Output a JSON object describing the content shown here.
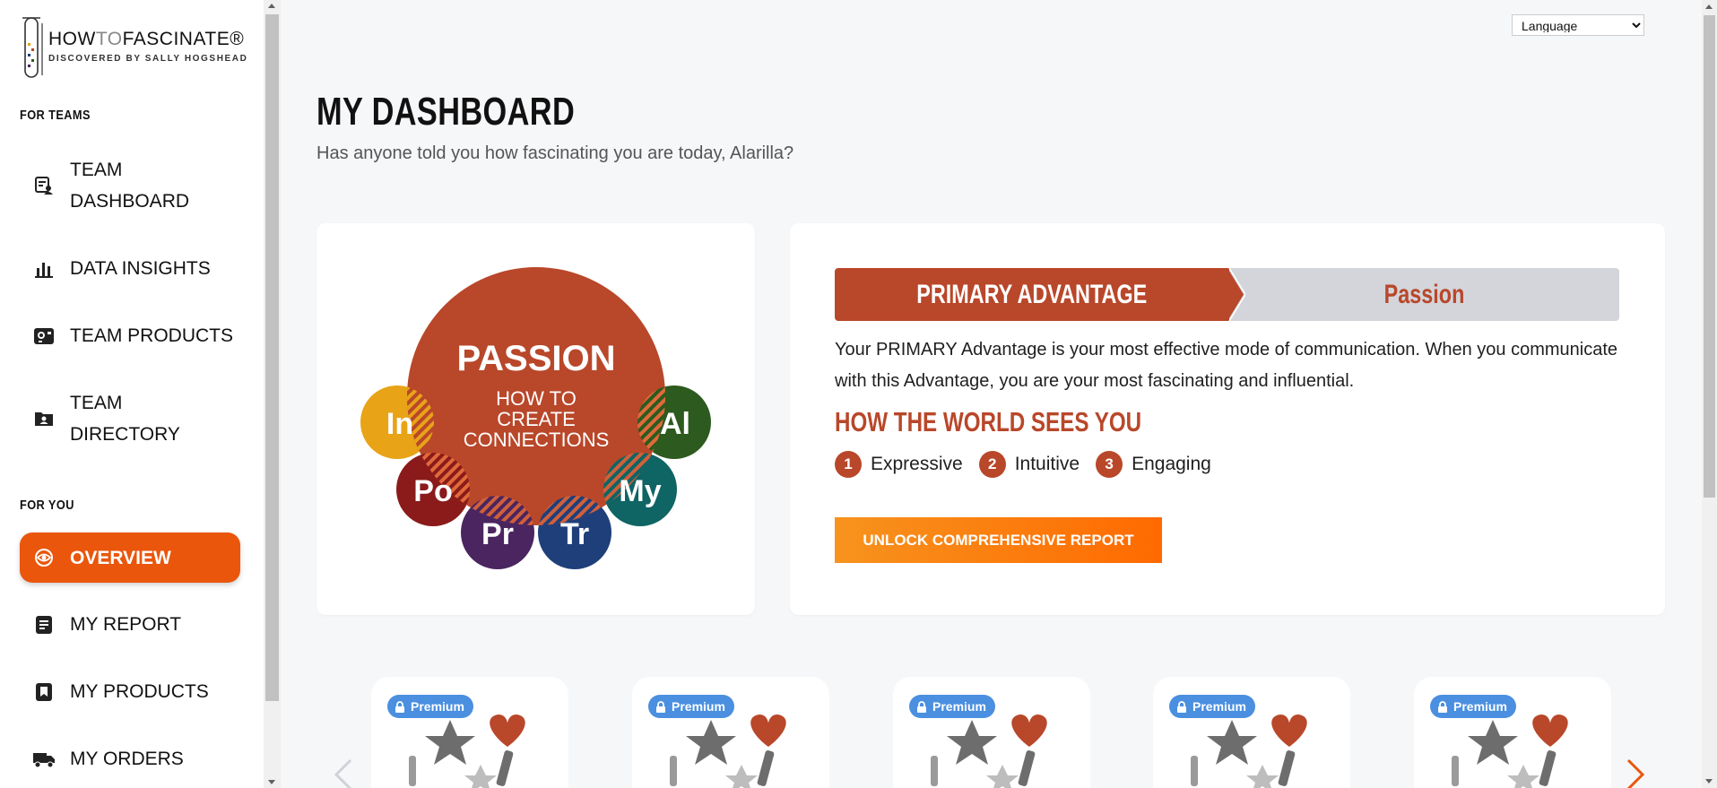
{
  "brand": {
    "name_part1": "HOW",
    "name_part2": "TO",
    "name_part3": "FASCINATE®",
    "tagline": "DISCOVERED BY SALLY HOGSHEAD"
  },
  "sidebar": {
    "teams_label": "FOR TEAMS",
    "you_label": "FOR YOU",
    "team_items": [
      {
        "label_line1": "TEAM",
        "label_line2": "DASHBOARD",
        "icon": "team-dashboard-icon"
      },
      {
        "label_line1": "DATA INSIGHTS",
        "icon": "bar-chart-icon"
      },
      {
        "label_line1": "TEAM PRODUCTS",
        "icon": "team-products-icon"
      },
      {
        "label_line1": "TEAM",
        "label_line2": "DIRECTORY",
        "icon": "folder-user-icon"
      }
    ],
    "you_items": [
      {
        "label": "OVERVIEW",
        "icon": "eye-icon",
        "active": true
      },
      {
        "label": "MY REPORT",
        "icon": "report-icon"
      },
      {
        "label": "MY PRODUCTS",
        "icon": "bookmark-icon"
      },
      {
        "label": "MY ORDERS",
        "icon": "truck-icon"
      }
    ]
  },
  "header": {
    "language_label": "Language"
  },
  "main": {
    "title": "MY DASHBOARD",
    "subtitle": "Has anyone told you how fascinating you are today, Alarilla?"
  },
  "advantage_graphic": {
    "center_title": "PASSION",
    "center_sub1": "HOW TO",
    "center_sub2": "CREATE",
    "center_sub3": "CONNECTIONS",
    "bubbles": [
      {
        "label": "In",
        "color": "#e8a317"
      },
      {
        "label": "Po",
        "color": "#8b1a1a"
      },
      {
        "label": "Pr",
        "color": "#4a2560"
      },
      {
        "label": "Tr",
        "color": "#1f3f7a"
      },
      {
        "label": "My",
        "color": "#0f6464"
      },
      {
        "label": "Al",
        "color": "#2d5a1e"
      }
    ],
    "center_color": "#b9472a"
  },
  "primary_advantage": {
    "label": "PRIMARY ADVANTAGE",
    "value": "Passion",
    "description": "Your PRIMARY Advantage is your most effective mode of communication. When you communicate with this Advantage, you are your most fascinating and influential.",
    "world_title": "HOW THE WORLD SEES YOU",
    "traits": [
      {
        "num": "1",
        "label": "Expressive"
      },
      {
        "num": "2",
        "label": "Intuitive"
      },
      {
        "num": "3",
        "label": "Engaging"
      }
    ],
    "unlock_label": "UNLOCK COMPREHENSIVE REPORT"
  },
  "products": [
    {
      "badge": "Premium"
    },
    {
      "badge": "Premium"
    },
    {
      "badge": "Premium"
    },
    {
      "badge": "Premium"
    },
    {
      "badge": "Premium"
    }
  ],
  "colors": {
    "accent_orange": "#e9560c",
    "passion_red": "#b9472a",
    "premium_blue": "#4a8fe0"
  }
}
